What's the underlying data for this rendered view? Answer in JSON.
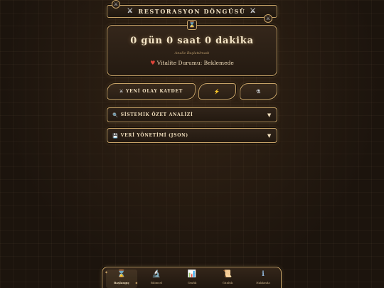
{
  "header": {
    "title": "RESTORASYON DÖNGÜSÜ",
    "left_icon": "crossed-swords",
    "right_icon": "crossed-swords",
    "corner_icon": "crossed-swords"
  },
  "timer": {
    "icon": "hourglass",
    "value": "0 gün 0 saat 0 dakika",
    "subtitle": "Analiz Başlatılmadı",
    "vitality_icon": "heart",
    "vitality_text": "Vitalite Durumu: Beklemede"
  },
  "actions": {
    "new_event_icon": "crossed-swords",
    "new_event_label": "YENİ OLAY KAYDET",
    "quick_icon": "lightning",
    "analysis_icon": "flask"
  },
  "sections": {
    "summary_label": "SİSTEMİK ÖZET ANALİZİ",
    "summary_icon": "magnifier",
    "data_label": "VERİ YÖNETİMİ (JSON)",
    "data_icon": "floppy-disk",
    "arrow": "▼"
  },
  "nav": {
    "items": [
      {
        "label": "Başlangıç",
        "icon": "hourglass"
      },
      {
        "label": "Bilimsel",
        "icon": "microscope"
      },
      {
        "label": "Grafik",
        "icon": "chart"
      },
      {
        "label": "Günlük",
        "icon": "scroll"
      },
      {
        "label": "Hakkında",
        "icon": "info"
      }
    ],
    "active_index": 0
  },
  "colors": {
    "background": "#1c140d",
    "gold_border": "#c9a468",
    "text": "#f1dfbd",
    "heart": "#e0453a",
    "bolt": "#f2c54b"
  }
}
